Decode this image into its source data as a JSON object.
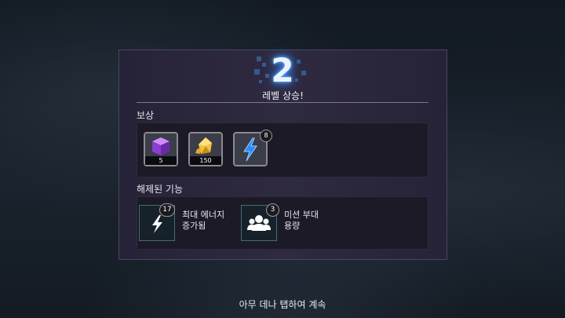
{
  "level": {
    "number": "2",
    "title": "레벨 상승!"
  },
  "rewards": {
    "label": "보상",
    "items": [
      {
        "icon": "purple-cube-icon",
        "quantity": "5"
      },
      {
        "icon": "gold-crystal-icon",
        "quantity": "150"
      },
      {
        "icon": "lightning-energy-icon",
        "badge": "8"
      }
    ]
  },
  "unlocked": {
    "label": "해제된 기능",
    "features": [
      {
        "icon": "lightning-icon",
        "badge": "17",
        "text_line1": "최대 에너지",
        "text_line2": "증가됨"
      },
      {
        "icon": "squad-icon",
        "badge": "3",
        "text_line1": "미션 부대",
        "text_line2": "용량"
      }
    ]
  },
  "continue_text": "아무 데나 탭하여 계속"
}
